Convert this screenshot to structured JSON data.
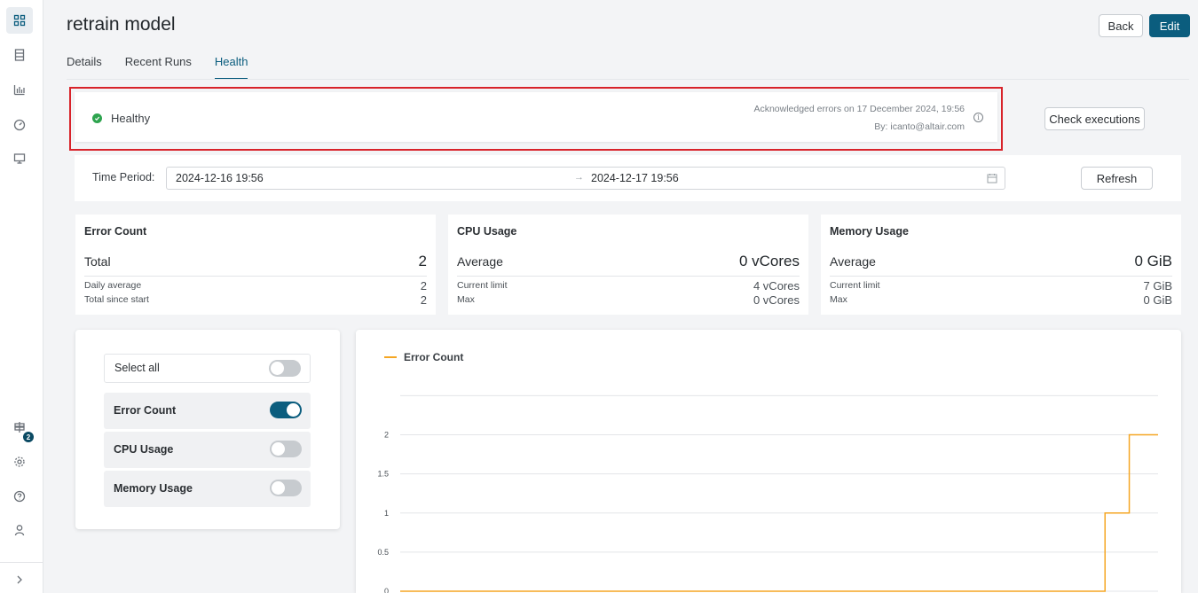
{
  "sidebar": {
    "items": [
      {
        "icon": "dashboard-grid-icon",
        "active": true
      },
      {
        "icon": "document-list-icon",
        "active": false
      },
      {
        "icon": "bar-chart-icon",
        "active": false
      },
      {
        "icon": "gauge-icon",
        "active": false
      },
      {
        "icon": "monitor-icon",
        "active": false
      }
    ],
    "bottom_items": [
      {
        "icon": "signpost-icon"
      },
      {
        "icon": "gear-icon"
      },
      {
        "icon": "help-circle-icon"
      },
      {
        "icon": "user-icon"
      }
    ],
    "notification_count": "2",
    "expand_icon": "chevron-right-icon"
  },
  "header": {
    "title": "retrain model",
    "back_label": "Back",
    "edit_label": "Edit"
  },
  "tabs": [
    {
      "label": "Details",
      "active": false
    },
    {
      "label": "Recent Runs",
      "active": false
    },
    {
      "label": "Health",
      "active": true
    }
  ],
  "health": {
    "status": "Healthy",
    "status_color": "#2ea44f",
    "acknowledged": "Acknowledged errors on 17 December 2024, 19:56",
    "by": "By: icanto@altair.com",
    "check_executions_label": "Check executions"
  },
  "period": {
    "label": "Time Period:",
    "start": "2024-12-16 19:56",
    "end": "2024-12-17 19:56",
    "refresh_label": "Refresh"
  },
  "stats": {
    "error": {
      "title": "Error Count",
      "main_label": "Total",
      "main_value": "2",
      "rows": [
        {
          "label": "Daily average",
          "value": "2"
        },
        {
          "label": "Total since start",
          "value": "2"
        }
      ]
    },
    "cpu": {
      "title": "CPU Usage",
      "main_label": "Average",
      "main_value": "0 vCores",
      "rows": [
        {
          "label": "Current limit",
          "value": "4 vCores"
        },
        {
          "label": "Max",
          "value": "0 vCores"
        }
      ]
    },
    "memory": {
      "title": "Memory Usage",
      "main_label": "Average",
      "main_value": "0 GiB",
      "rows": [
        {
          "label": "Current limit",
          "value": "7 GiB"
        },
        {
          "label": "Max",
          "value": "0 GiB"
        }
      ]
    }
  },
  "toggles": {
    "select_all": {
      "label": "Select all",
      "on": false
    },
    "items": [
      {
        "label": "Error Count",
        "on": true
      },
      {
        "label": "CPU Usage",
        "on": false
      },
      {
        "label": "Memory Usage",
        "on": false
      }
    ]
  },
  "colors": {
    "accent": "#0b5d7e",
    "highlight_border": "#d8232a",
    "series": "#f5a623"
  },
  "chart_data": {
    "type": "line",
    "step": true,
    "title": "",
    "xlabel": "",
    "ylabel": "",
    "ylim": [
      0,
      2.5
    ],
    "yticks": [
      0,
      0.5,
      1,
      1.5,
      2
    ],
    "ytick_labels": [
      "0",
      "0.5",
      "1",
      "1.5",
      "2"
    ],
    "grid": true,
    "legend": "top-left",
    "series": [
      {
        "name": "Error Count",
        "color": "#f5a623",
        "x": [
          0,
          0.93,
          0.93,
          0.962,
          0.962,
          1
        ],
        "y": [
          0,
          0,
          1,
          1,
          2,
          2
        ]
      }
    ]
  }
}
